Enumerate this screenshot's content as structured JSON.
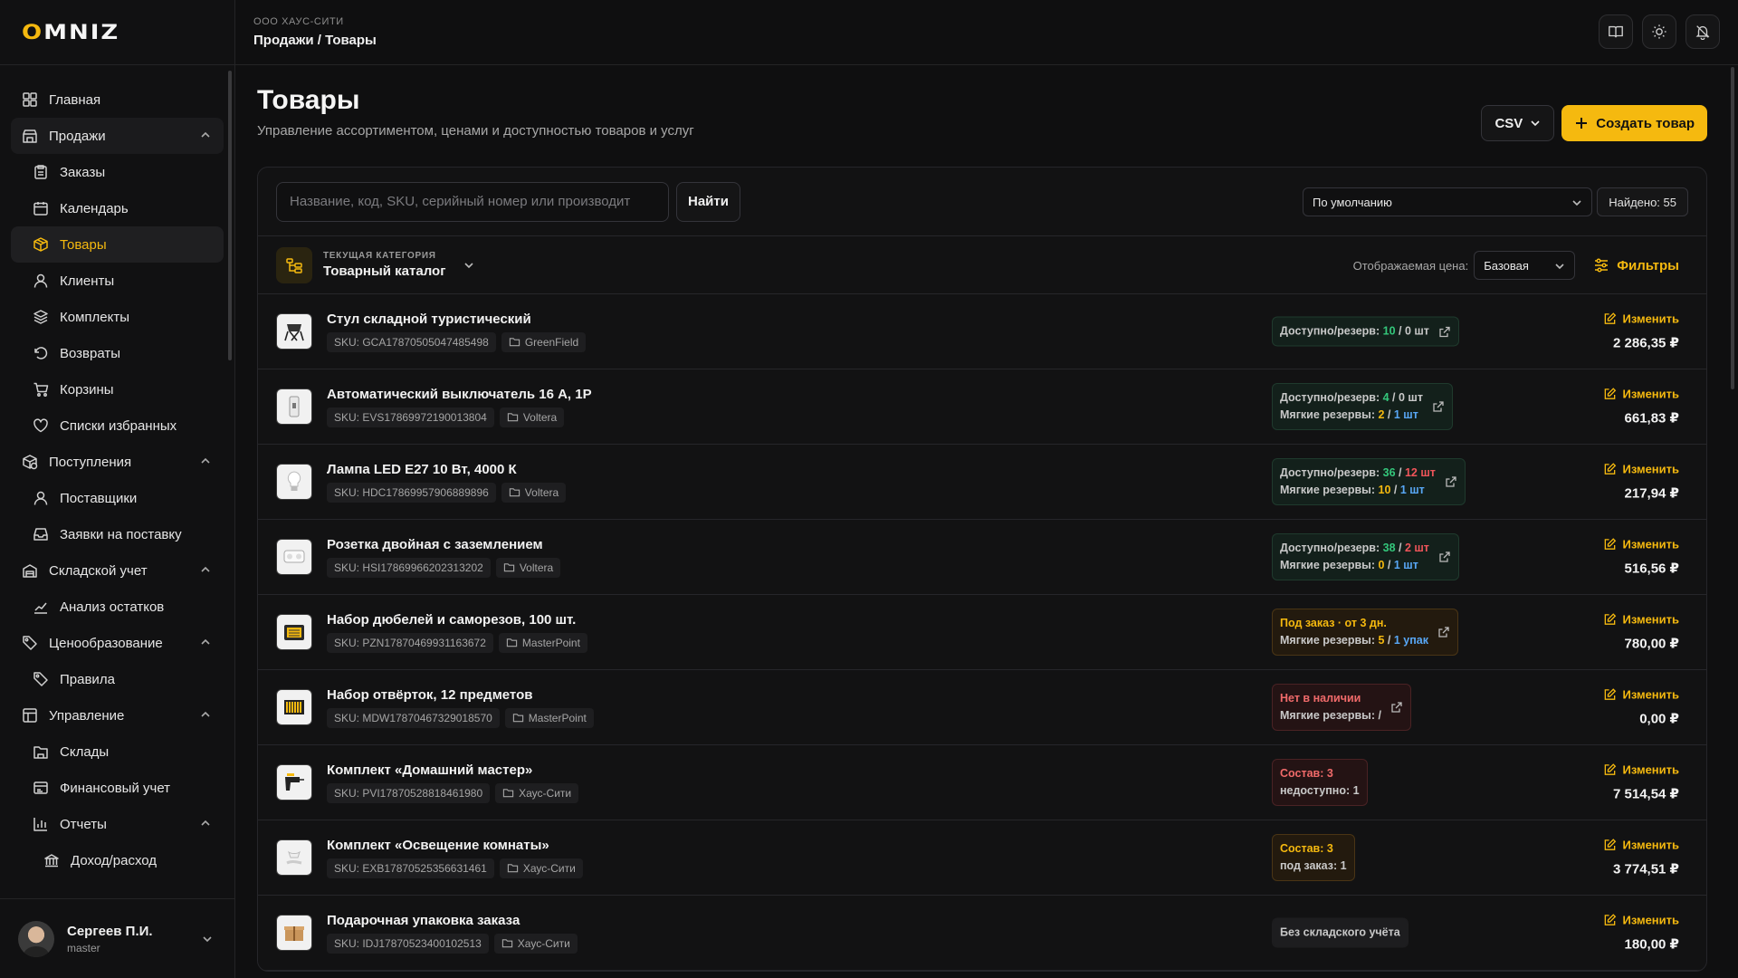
{
  "logo": "OMNIZ",
  "org": "ООО ХАУС-СИТИ",
  "breadcrumb": "Продажи / Товары",
  "nav": [
    {
      "label": "Главная",
      "level": 0,
      "icon": "grid-icon"
    },
    {
      "label": "Продажи",
      "level": 0,
      "icon": "store-icon",
      "open": true
    },
    {
      "label": "Заказы",
      "level": 1,
      "icon": "clipboard-icon"
    },
    {
      "label": "Календарь",
      "level": 1,
      "icon": "calendar-icon"
    },
    {
      "label": "Товары",
      "level": 1,
      "icon": "box-icon",
      "active": true
    },
    {
      "label": "Клиенты",
      "level": 1,
      "icon": "user-icon"
    },
    {
      "label": "Комплекты",
      "level": 1,
      "icon": "layers-icon"
    },
    {
      "label": "Возвраты",
      "level": 1,
      "icon": "undo-icon"
    },
    {
      "label": "Корзины",
      "level": 1,
      "icon": "cart-icon"
    },
    {
      "label": "Списки избранных",
      "level": 1,
      "icon": "heart-icon"
    },
    {
      "label": "Поступления",
      "level": 0,
      "icon": "package-icon",
      "open": true
    },
    {
      "label": "Поставщики",
      "level": 1,
      "icon": "user-icon"
    },
    {
      "label": "Заявки на поставку",
      "level": 1,
      "icon": "inbox-icon"
    },
    {
      "label": "Складской учет",
      "level": 0,
      "icon": "warehouse-icon",
      "open": true
    },
    {
      "label": "Анализ остатков",
      "level": 1,
      "icon": "chart-line-icon"
    },
    {
      "label": "Ценообразование",
      "level": 0,
      "icon": "tags-icon",
      "open": true
    },
    {
      "label": "Правила",
      "level": 1,
      "icon": "tag-icon"
    },
    {
      "label": "Управление",
      "level": 0,
      "icon": "layout-icon",
      "open": true
    },
    {
      "label": "Склады",
      "level": 1,
      "icon": "folder-icon"
    },
    {
      "label": "Финансовый учет",
      "level": 1,
      "icon": "finance-icon"
    },
    {
      "label": "Отчеты",
      "level": 1,
      "icon": "bar-chart-icon",
      "open": true
    },
    {
      "label": "Доход/расход",
      "level": 2,
      "icon": "bank-icon"
    }
  ],
  "user": {
    "name": "Сергеев П.И.",
    "role": "master"
  },
  "page": {
    "title": "Товары",
    "subtitle": "Управление ассортиментом, ценами и доступностью товаров и услуг"
  },
  "actions": {
    "csv": "CSV",
    "create": "Создать товар"
  },
  "search": {
    "placeholder": "Название, код, SKU, серийный номер или производит",
    "value": "",
    "button": "Найти"
  },
  "sort": {
    "selected": "По умолчанию"
  },
  "found": "Найдено: 55",
  "category": {
    "kicker": "ТЕКУЩАЯ КАТЕГОРИЯ",
    "name": "Товарный каталог"
  },
  "price_view": {
    "label": "Отображаемая цена:",
    "selected": "Базовая"
  },
  "filters_label": "Фильтры",
  "edit_label": "Изменить",
  "colors": {
    "accent": "#f5b90f",
    "ok": "#34c77b",
    "danger": "#f0555a",
    "info": "#58a7f5"
  },
  "products": [
    {
      "name": "Стул складной туристический",
      "sku": "SKU: GCA17870505047485498",
      "brand": "GreenField",
      "thumb": "chair",
      "stock_style": "ok",
      "stock": [
        [
          [
            "Доступно/резерв: ",
            "lbl"
          ],
          [
            "10",
            "green"
          ],
          [
            " / ",
            "lbl"
          ],
          [
            "0 шт",
            "lbl"
          ]
        ]
      ],
      "price": "2 286,35 ₽"
    },
    {
      "name": "Автоматический выключатель 16 А, 1Р",
      "sku": "SKU: EVS17869972190013804",
      "brand": "Voltera",
      "thumb": "breaker",
      "stock_style": "ok",
      "stock": [
        [
          [
            "Доступно/резерв: ",
            "lbl"
          ],
          [
            "4",
            "green"
          ],
          [
            " / ",
            "lbl"
          ],
          [
            "0 шт",
            "lbl"
          ]
        ],
        [
          [
            "Мягкие резервы: ",
            "lbl"
          ],
          [
            "2",
            "yellow"
          ],
          [
            " / ",
            "lbl"
          ],
          [
            "1 шт",
            "blue"
          ]
        ]
      ],
      "price": "661,83 ₽"
    },
    {
      "name": "Лампа LED E27 10 Вт, 4000 К",
      "sku": "SKU: HDC17869957906889896",
      "brand": "Voltera",
      "thumb": "bulb",
      "stock_style": "ok",
      "stock": [
        [
          [
            "Доступно/резерв: ",
            "lbl"
          ],
          [
            "36",
            "green"
          ],
          [
            " / ",
            "lbl"
          ],
          [
            "12 шт",
            "red"
          ]
        ],
        [
          [
            "Мягкие резервы: ",
            "lbl"
          ],
          [
            "10",
            "yellow"
          ],
          [
            " / ",
            "lbl"
          ],
          [
            "1 шт",
            "blue"
          ]
        ]
      ],
      "price": "217,94 ₽"
    },
    {
      "name": "Розетка двойная с заземлением",
      "sku": "SKU: HSI17869966202313202",
      "brand": "Voltera",
      "thumb": "socket",
      "stock_style": "ok",
      "stock": [
        [
          [
            "Доступно/резерв: ",
            "lbl"
          ],
          [
            "38",
            "green"
          ],
          [
            " / ",
            "lbl"
          ],
          [
            "2 шт",
            "red"
          ]
        ],
        [
          [
            "Мягкие резервы: ",
            "lbl"
          ],
          [
            "0",
            "yellow"
          ],
          [
            " / ",
            "lbl"
          ],
          [
            "1 шт",
            "blue"
          ]
        ]
      ],
      "price": "516,56 ₽"
    },
    {
      "name": "Набор дюбелей и саморезов, 100 шт.",
      "sku": "SKU: PZN17870469931163672",
      "brand": "MasterPoint",
      "thumb": "kit",
      "stock_style": "warn",
      "stock": [
        [
          [
            "Под заказ · от 3 дн.",
            "yellow"
          ]
        ],
        [
          [
            "Мягкие резервы: ",
            "lbl"
          ],
          [
            "5",
            "yellow"
          ],
          [
            " / ",
            "lbl"
          ],
          [
            "1 упак",
            "blue"
          ]
        ]
      ],
      "price": "780,00 ₽"
    },
    {
      "name": "Набор отвёрток, 12 предметов",
      "sku": "SKU: MDW17870467329018570",
      "brand": "MasterPoint",
      "thumb": "screwdrivers",
      "stock_style": "bad",
      "stock": [
        [
          [
            "Нет в наличии",
            "badred"
          ]
        ],
        [
          [
            "Мягкие резервы: ",
            "lbl"
          ],
          [
            " / ",
            "lbl"
          ]
        ]
      ],
      "price": "0,00 ₽"
    },
    {
      "name": "Комплект «Домашний мастер»",
      "sku": "SKU: PVI17870528818461980",
      "brand": "Хаус-Сити",
      "thumb": "drill",
      "stock_style": "bad",
      "noext": true,
      "stock": [
        [
          [
            "Состав: 3",
            "badred"
          ]
        ],
        [
          [
            "недоступно: 1",
            "lbl"
          ]
        ]
      ],
      "price": "7 514,54 ₽"
    },
    {
      "name": "Комплект «Освещение комнаты»",
      "sku": "SKU: EXB17870525356631461",
      "brand": "Хаус-Сити",
      "thumb": "lamp",
      "stock_style": "warn",
      "noext": true,
      "stock": [
        [
          [
            "Состав: 3",
            "yellow"
          ]
        ],
        [
          [
            "под заказ: 1",
            "lbl"
          ]
        ]
      ],
      "price": "3 774,51 ₽"
    },
    {
      "name": "Подарочная упаковка заказа",
      "sku": "SKU: IDJ17870523400102513",
      "brand": "Хаус-Сити",
      "thumb": "giftbox",
      "stock_style": "none",
      "noext": true,
      "stock": [
        [
          [
            "Без складского учёта",
            "lbl"
          ]
        ]
      ],
      "price": "180,00 ₽"
    }
  ]
}
